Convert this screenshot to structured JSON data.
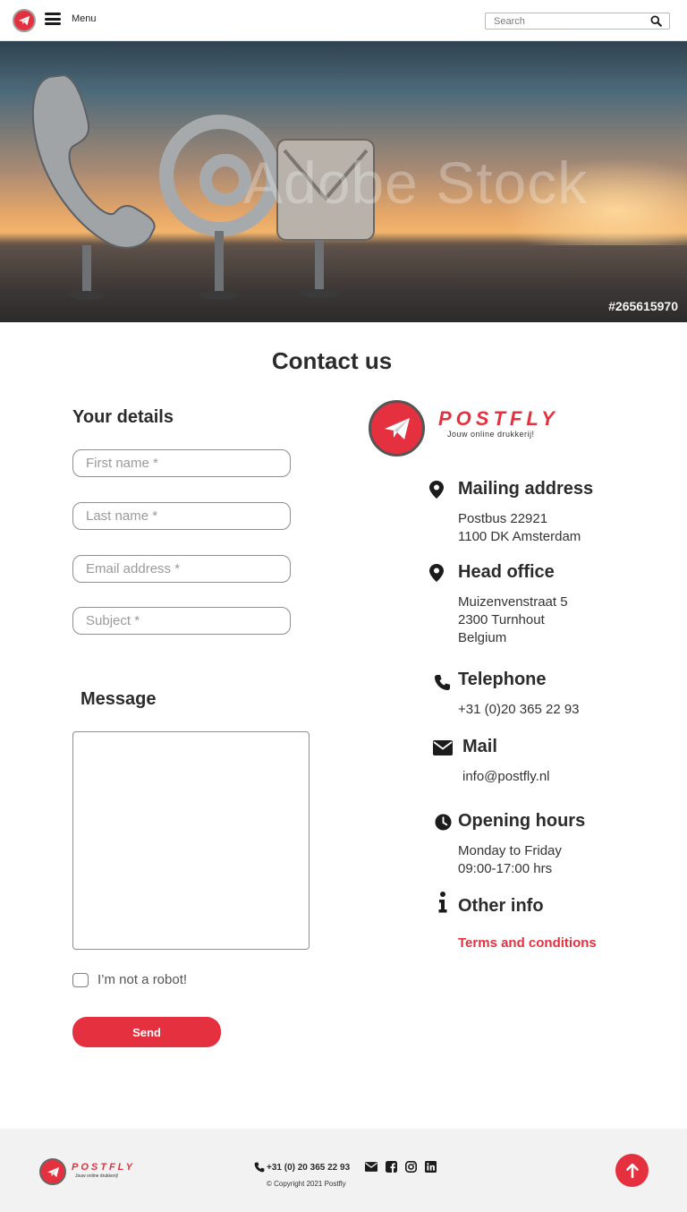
{
  "header": {
    "menu_label": "Menu",
    "search_placeholder": "Search"
  },
  "hero": {
    "watermark": "Adobe Stock",
    "stock_id": "#265615970"
  },
  "page": {
    "title": "Contact us"
  },
  "form": {
    "heading": "Your details",
    "first_name_placeholder": "First name *",
    "last_name_placeholder": "Last name *",
    "email_placeholder": "Email address *",
    "subject_placeholder": "Subject *",
    "message_heading": "Message",
    "robot_label": "I’m not a robot!",
    "send_label": "Send"
  },
  "brand": {
    "name": "POSTFLY",
    "tagline": "Jouw online drukkerij!"
  },
  "info": {
    "mailing": {
      "title": "Mailing address",
      "line1": "Postbus 22921",
      "line2": "1100 DK Amsterdam"
    },
    "head_office": {
      "title": "Head office",
      "line1": "Muizenvenstraat 5",
      "line2": "2300 Turnhout",
      "line3": "Belgium"
    },
    "telephone": {
      "title": "Telephone",
      "value": "+31 (0)20 365 22 93"
    },
    "mail": {
      "title": "Mail",
      "value": "info@postfly.nl"
    },
    "hours": {
      "title": "Opening hours",
      "line1": "Monday to Friday",
      "line2": "09:00-17:00 hrs"
    },
    "other": {
      "title": "Other info",
      "link": "Terms and conditions"
    }
  },
  "footer": {
    "phone": "+31 (0) 20 365 22 93",
    "copyright": "© Copyright 2021 Postfly",
    "brand_name": "POSTFLY",
    "brand_tagline": "Jouw online drukkerij!"
  },
  "colors": {
    "accent": "#e5313f",
    "text": "#2b2b2b",
    "footer_bg": "#f2f2f2"
  },
  "icons": [
    "plane-icon",
    "menu-icon",
    "search-icon",
    "map-marker-icon",
    "phone-icon",
    "envelope-icon",
    "clock-icon",
    "info-icon",
    "facebook-icon",
    "instagram-icon",
    "linkedin-icon",
    "arrow-up-icon"
  ]
}
